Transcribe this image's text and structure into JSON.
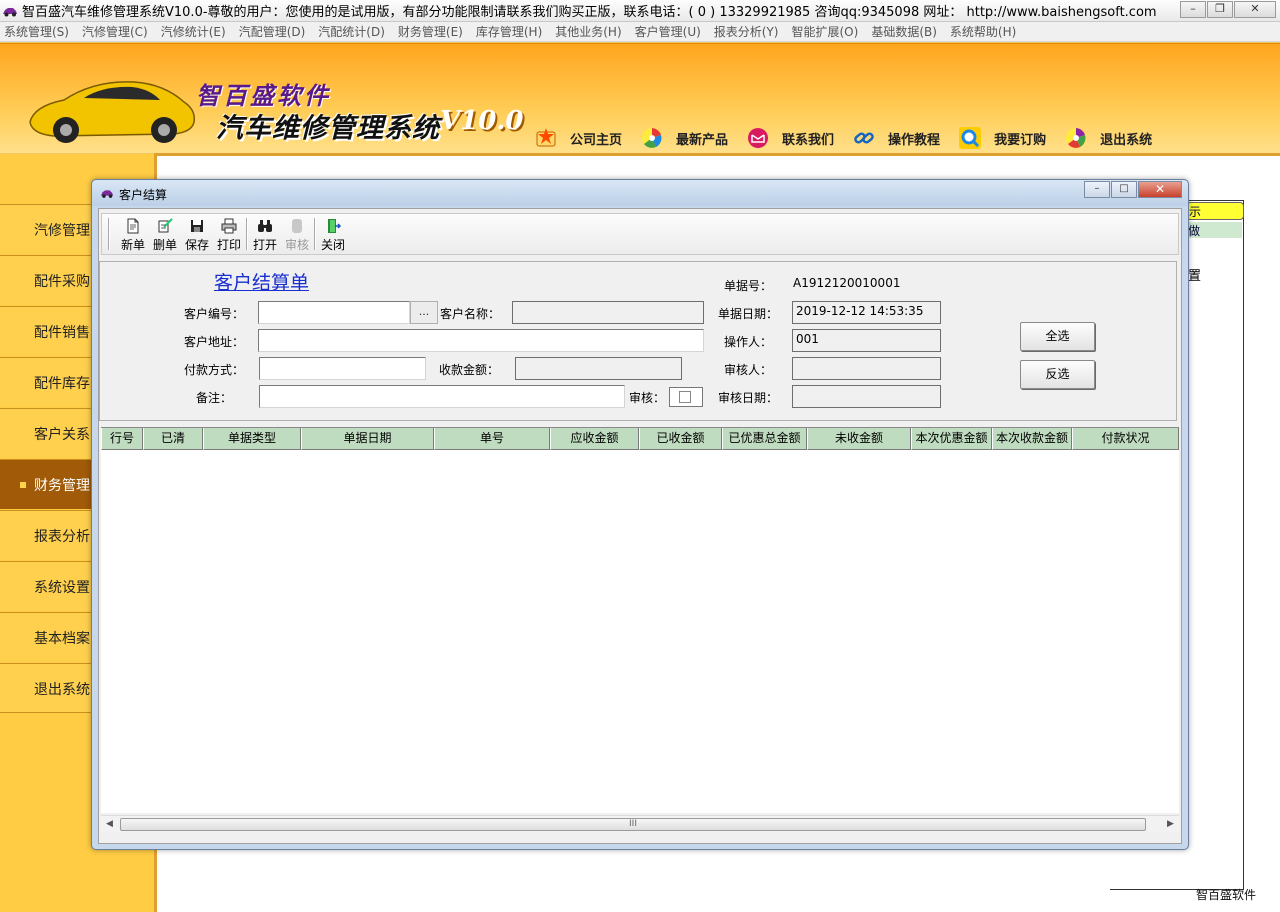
{
  "window": {
    "title": "智百盛汽车维修管理系统V10.0-尊敬的用户：您使用的是试用版，有部分功能限制请联系我们购买正版，联系电话：( 0 ) 13329921985  咨询qq:9345098   网址： http://www.baishengsoft.com"
  },
  "menu": [
    "系统管理(S)",
    "汽修管理(C)",
    "汽修统计(E)",
    "汽配管理(D)",
    "汽配统计(D)",
    "财务管理(E)",
    "库存管理(H)",
    "其他业务(H)",
    "客户管理(U)",
    "报表分析(Y)",
    "智能扩展(O)",
    "基础数据(B)",
    "系统帮助(H)"
  ],
  "banner": {
    "brand_top": "智百盛软件",
    "brand_main": "汽车维修管理系统",
    "version": "V10.0",
    "nav": [
      "公司主页",
      "最新产品",
      "联系我们",
      "操作教程",
      "我要订购",
      "退出系统"
    ]
  },
  "sidebar": {
    "items": [
      "汽修管理",
      "配件采购",
      "配件销售",
      "配件库存",
      "客户关系",
      "财务管理",
      "报表分析",
      "系统设置",
      "基本档案",
      "退出系统"
    ],
    "active_index": 5
  },
  "behind": {
    "yellow_text": "示",
    "green_text": "做",
    "side_text": "置",
    "footer": "智百盛软件"
  },
  "dialog": {
    "title": "客户结算",
    "toolbar": [
      {
        "label": "新单",
        "icon": "new-doc-icon",
        "enabled": true
      },
      {
        "label": "删单",
        "icon": "delete-doc-icon",
        "enabled": true
      },
      {
        "label": "保存",
        "icon": "save-icon",
        "enabled": true
      },
      {
        "label": "打印",
        "icon": "print-icon",
        "enabled": true
      },
      {
        "label": "打开",
        "icon": "binoculars-icon",
        "enabled": true
      },
      {
        "label": "审核",
        "icon": "audit-icon",
        "enabled": false
      },
      {
        "label": "关闭",
        "icon": "exit-door-icon",
        "enabled": true
      }
    ],
    "form": {
      "title": "客户结算单",
      "doc_no_label": "单据号：",
      "doc_no": "A1912120010001",
      "customer_code_label": "客户编号：",
      "customer_code": "",
      "browse_label": "...",
      "customer_name_label": "客户名称：",
      "customer_name": "",
      "doc_date_label": "单据日期：",
      "doc_date": "2019-12-12 14:53:35",
      "address_label": "客户地址：",
      "address": "",
      "operator_label": "操作人：",
      "operator": "001",
      "payment_label": "付款方式：",
      "payment": "",
      "amount_label": "收款金额：",
      "amount": "",
      "auditor_label": "审核人：",
      "auditor": "",
      "remark_label": "备注：",
      "remark": "",
      "audit_label": "审核：",
      "audit_date_label": "审核日期：",
      "audit_date": "",
      "select_all": "全选",
      "invert": "反选"
    },
    "grid": {
      "columns": [
        "行号",
        "已清",
        "单据类型",
        "单据日期",
        "单号",
        "应收金额",
        "已收金额",
        "已优惠总金额",
        "未收金额",
        "本次优惠金额",
        "本次收款金额",
        "付款状况"
      ]
    },
    "scroll_label": "III"
  }
}
